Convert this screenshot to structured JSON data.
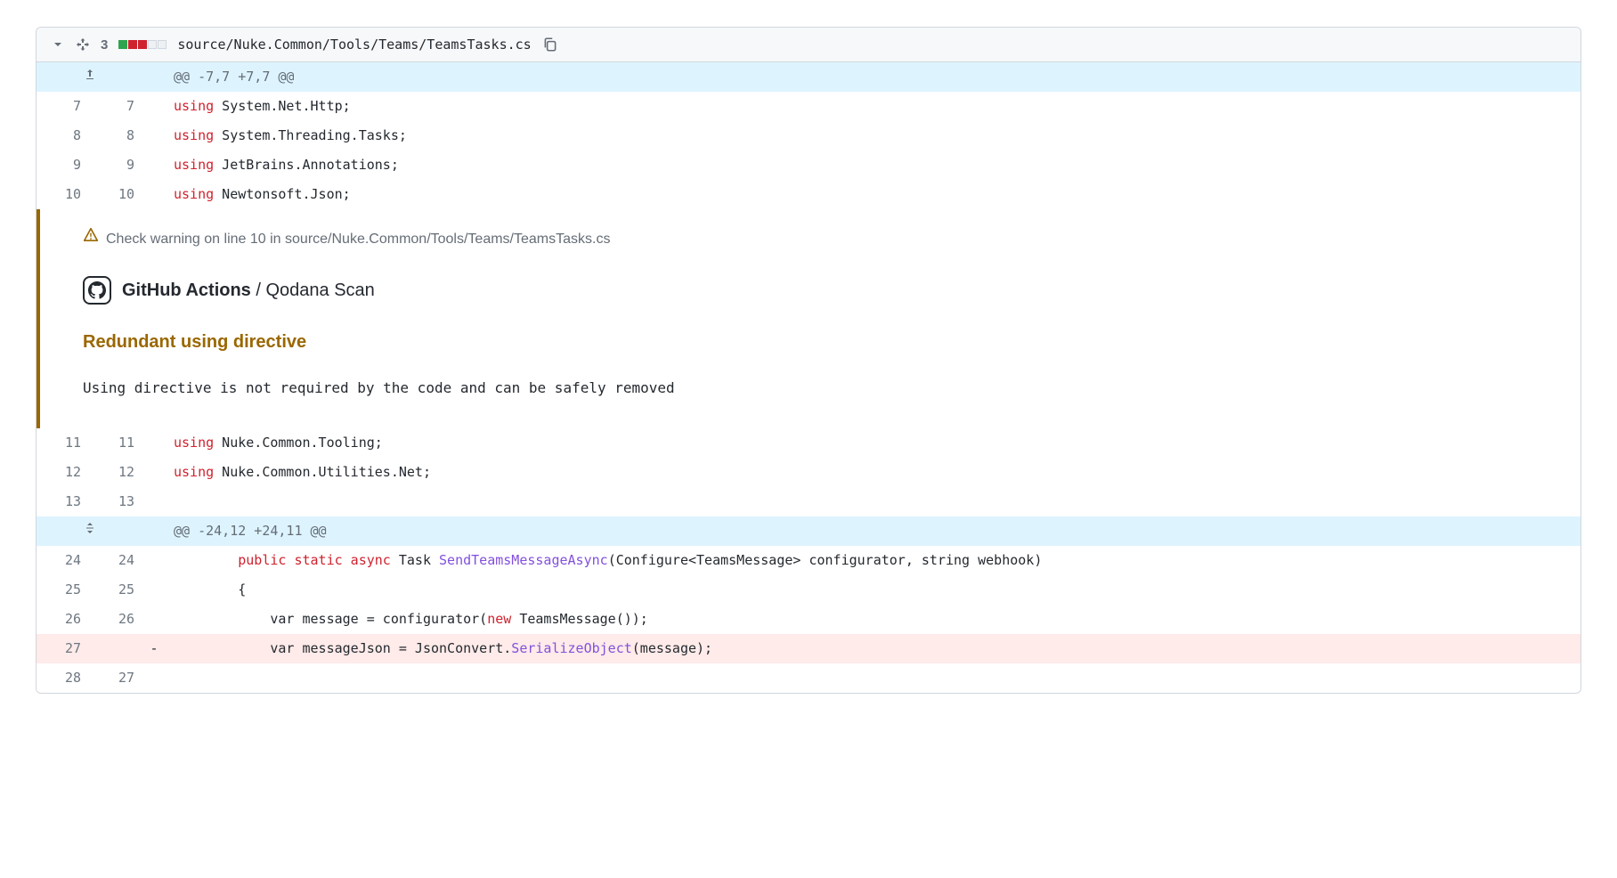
{
  "header": {
    "change_count": "3",
    "diff_stat": [
      "add",
      "del",
      "del",
      "neutral",
      "neutral"
    ],
    "file_path": "source/Nuke.Common/Tools/Teams/TeamsTasks.cs"
  },
  "hunks": {
    "h1": "@@ -7,7 +7,7 @@",
    "h2": "@@ -24,12 +24,11 @@"
  },
  "lines": {
    "l7": {
      "old": "7",
      "new": "7",
      "tokens": [
        [
          "kw-using",
          "using"
        ],
        [
          "",
          " System.Net.Http;"
        ]
      ]
    },
    "l8": {
      "old": "8",
      "new": "8",
      "tokens": [
        [
          "kw-using",
          "using"
        ],
        [
          "",
          " System.Threading.Tasks;"
        ]
      ]
    },
    "l9": {
      "old": "9",
      "new": "9",
      "tokens": [
        [
          "kw-using",
          "using"
        ],
        [
          "",
          " JetBrains.Annotations;"
        ]
      ]
    },
    "l10": {
      "old": "10",
      "new": "10",
      "tokens": [
        [
          "kw-using",
          "using"
        ],
        [
          "",
          " Newtonsoft.Json;"
        ]
      ]
    },
    "l11": {
      "old": "11",
      "new": "11",
      "tokens": [
        [
          "kw-using",
          "using"
        ],
        [
          "",
          " Nuke.Common.Tooling;"
        ]
      ]
    },
    "l12": {
      "old": "12",
      "new": "12",
      "tokens": [
        [
          "kw-using",
          "using"
        ],
        [
          "",
          " Nuke.Common.Utilities.Net;"
        ]
      ]
    },
    "l13": {
      "old": "13",
      "new": "13",
      "tokens": [
        [
          "",
          ""
        ]
      ]
    },
    "l24": {
      "old": "24",
      "new": "24",
      "tokens": [
        [
          "",
          "        "
        ],
        [
          "kw-mod",
          "public static async"
        ],
        [
          "",
          " Task "
        ],
        [
          "fn-name",
          "SendTeamsMessageAsync"
        ],
        [
          "",
          "(Configure<TeamsMessage> configurator, string webhook)"
        ]
      ]
    },
    "l25": {
      "old": "25",
      "new": "25",
      "tokens": [
        [
          "",
          "        {"
        ]
      ]
    },
    "l26": {
      "old": "26",
      "new": "26",
      "tokens": [
        [
          "",
          "            var message = configurator("
        ],
        [
          "kw-new",
          "new"
        ],
        [
          "",
          " TeamsMessage());"
        ]
      ]
    },
    "l27d": {
      "old": "27",
      "new": "",
      "marker": "-",
      "tokens": [
        [
          "",
          "            var messageJson = JsonConvert."
        ],
        [
          "fn-name",
          "SerializeObject"
        ],
        [
          "",
          "(message);"
        ]
      ]
    },
    "l28": {
      "old": "28",
      "new": "27",
      "tokens": [
        [
          "",
          ""
        ]
      ]
    }
  },
  "annotation": {
    "warning_prefix": "Check warning on line 10 in ",
    "warning_path": "source/Nuke.Common/Tools/Teams/TeamsTasks.cs",
    "source_bold": "GitHub Actions",
    "source_sep": " / ",
    "source_rest": "Qodana Scan",
    "title": "Redundant using directive",
    "description": "Using directive is not required by the code and can be safely removed"
  }
}
